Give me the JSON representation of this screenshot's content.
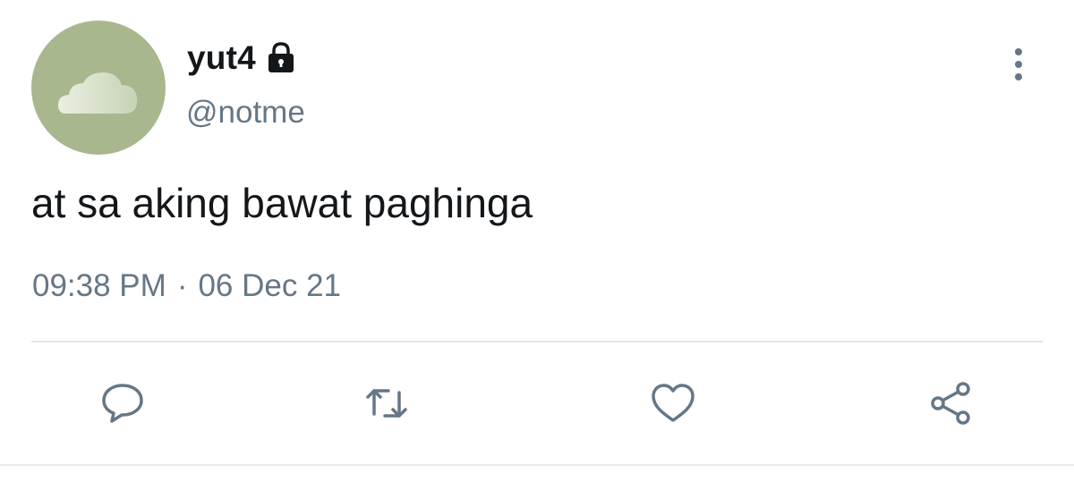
{
  "tweet": {
    "author": {
      "display_name": "yut4",
      "handle": "@notme",
      "protected_icon": "lock-icon",
      "avatar": "cloud-avatar"
    },
    "text": "at sa aking bawat paghinga",
    "time": "09:38 PM",
    "separator": "·",
    "date": "06 Dec 21"
  },
  "actions": [
    {
      "name": "reply",
      "icon": "speech-bubble-icon"
    },
    {
      "name": "retweet",
      "icon": "retweet-arrows-icon"
    },
    {
      "name": "like",
      "icon": "heart-icon"
    },
    {
      "name": "share",
      "icon": "share-nodes-icon"
    }
  ],
  "colors": {
    "text_primary": "#14171a",
    "text_secondary": "#657786",
    "avatar_bg": "#a8b78e",
    "divider": "#e1e8ed"
  }
}
